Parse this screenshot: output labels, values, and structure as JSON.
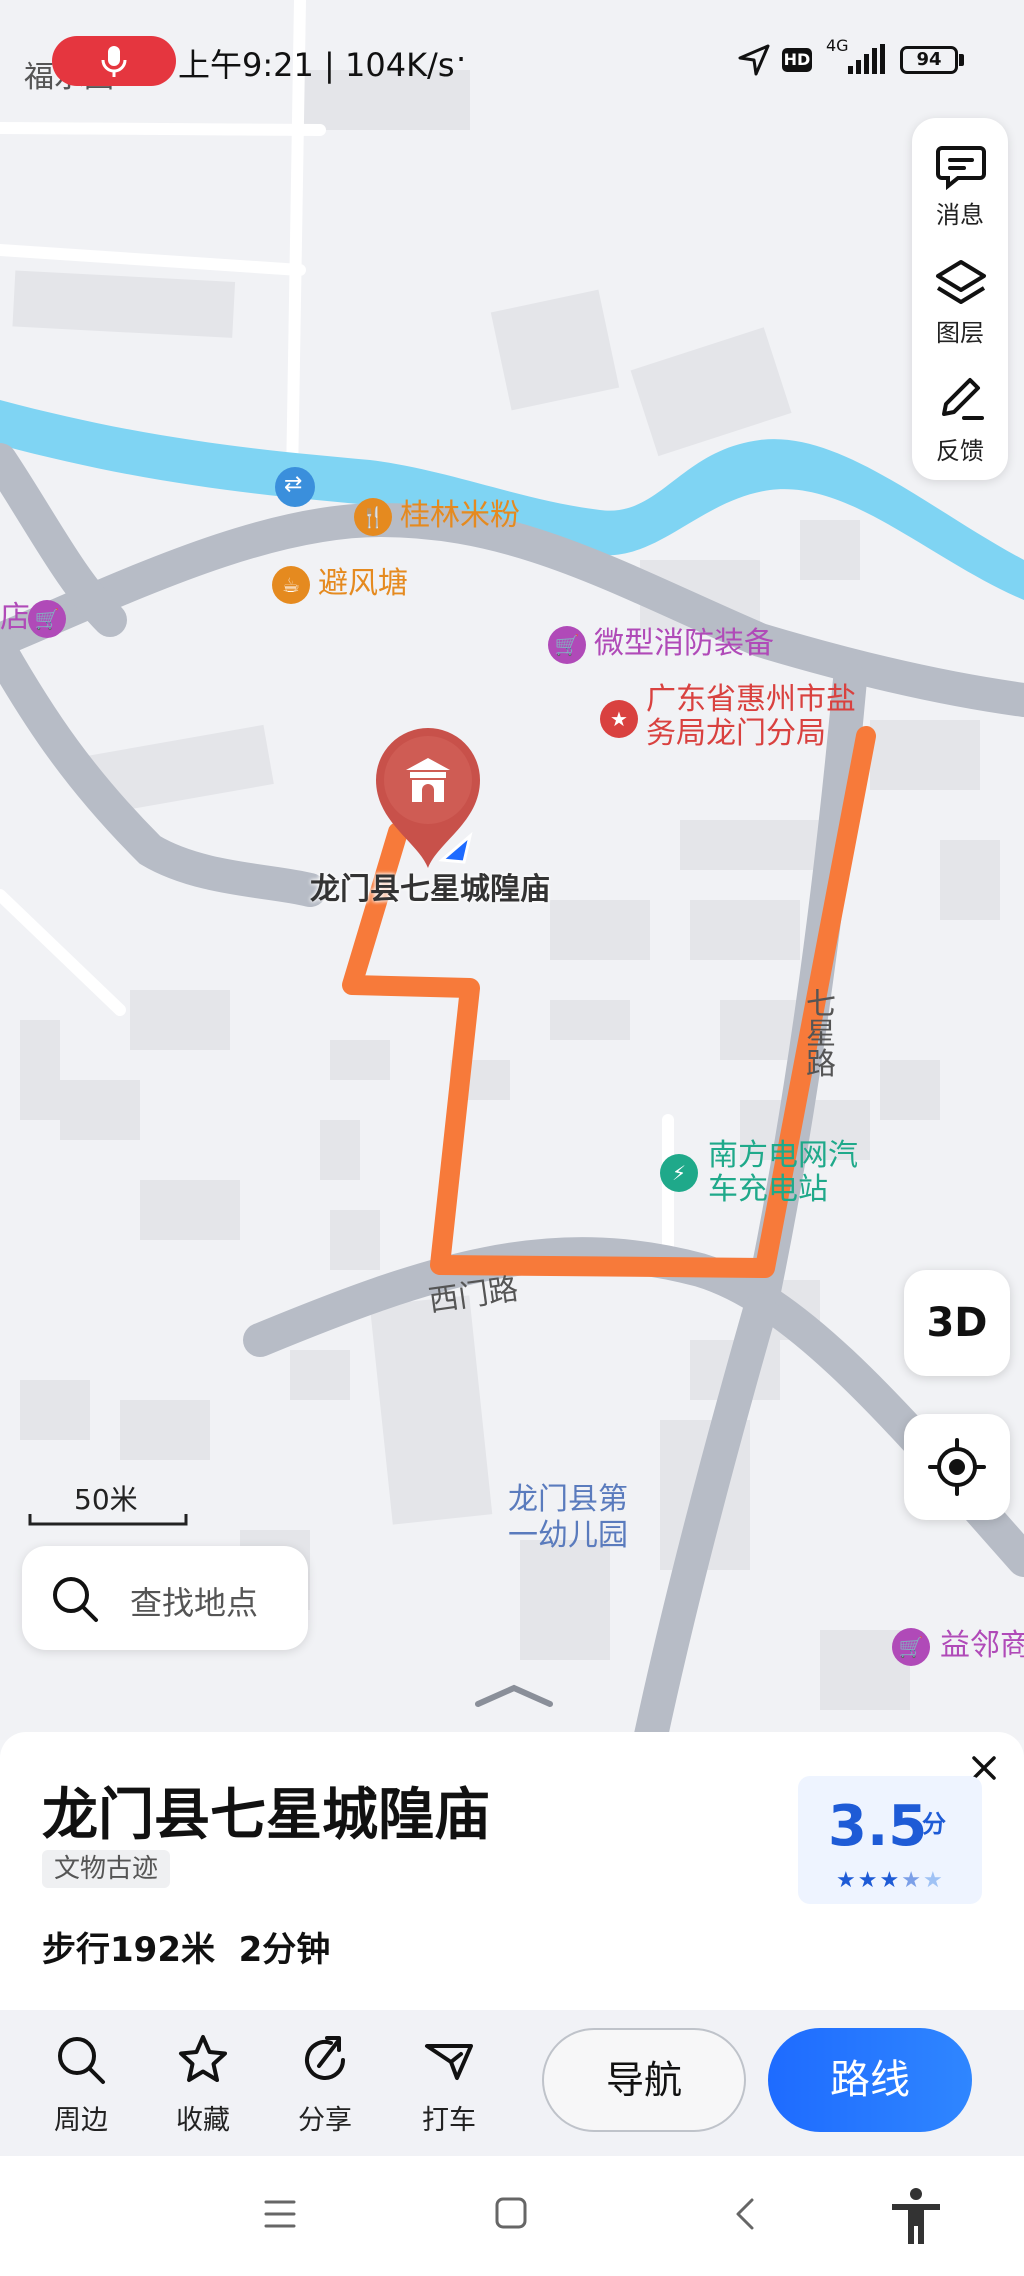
{
  "status_bar": {
    "time_speed": "上午9:21 | 104K/s",
    "dot": "·",
    "hd": "HD",
    "network": "4G",
    "battery": "94",
    "corner_place": "福水围"
  },
  "right_panel": [
    {
      "label": "消息",
      "icon": "message-icon"
    },
    {
      "label": "图层",
      "icon": "layers-icon"
    },
    {
      "label": "反馈",
      "icon": "edit-icon"
    }
  ],
  "map": {
    "pois": [
      {
        "label": "桂林米粉",
        "color": "#e58a1f"
      },
      {
        "label": "避风塘",
        "color": "#e58a1f"
      },
      {
        "label": "店",
        "color": "#b04ab8"
      },
      {
        "label": "微型消防装备",
        "color": "#b04ab8"
      },
      {
        "label": "广东省惠州市盐务局龙门分局",
        "line1": "广东省惠州市盐",
        "line2": "务局龙门分局",
        "color": "#d9413f"
      },
      {
        "label": "南方电网汽车充电站",
        "line1": "南方电网汽",
        "line2": "车充电站",
        "color": "#1fa98a"
      },
      {
        "label": "龙门县第一幼儿园",
        "line1": "龙门县第",
        "line2": "一幼儿园",
        "color": "#5a7bbd"
      },
      {
        "label": "益邻商",
        "color": "#b04ab8"
      }
    ],
    "roads": {
      "ximen": "西门路",
      "vertical": "七星路"
    },
    "pin_label": "龙门县七星城隍庙",
    "scale": "50米",
    "button_3d": "3D",
    "route_color": "#f77a3a"
  },
  "search": {
    "placeholder": "查找地点"
  },
  "sheet": {
    "title": "龙门县七星城隍庙",
    "tag": "文物古迹",
    "walk": "步行192米  2分钟",
    "rating": "3.5",
    "rating_unit": "分",
    "stars": 3.5
  },
  "actions": [
    {
      "label": "周边",
      "icon": "search-icon"
    },
    {
      "label": "收藏",
      "icon": "star-icon"
    },
    {
      "label": "分享",
      "icon": "share-icon"
    },
    {
      "label": "打车",
      "icon": "taxi-icon"
    }
  ],
  "buttons": {
    "navigate": "导航",
    "route": "路线"
  },
  "colors": {
    "primary": "#1e6bff",
    "rating_bg": "#eef4ff"
  }
}
